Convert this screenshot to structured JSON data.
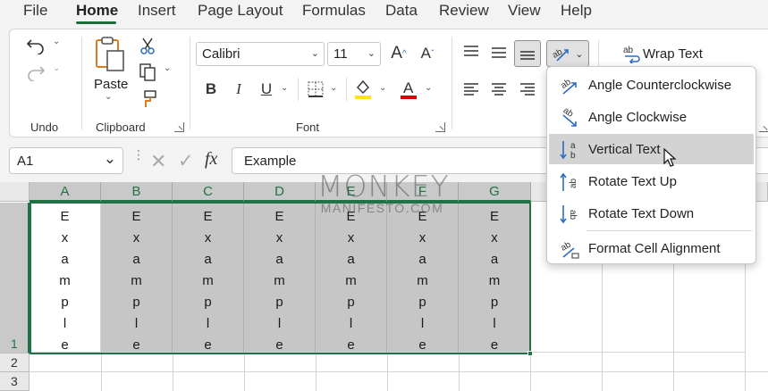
{
  "menu": {
    "tabs": [
      "File",
      "Home",
      "Insert",
      "Page Layout",
      "Formulas",
      "Data",
      "Review",
      "View",
      "Help"
    ],
    "active": "Home"
  },
  "ribbon": {
    "groups": {
      "undo": "Undo",
      "clipboard": "Clipboard",
      "font": "Font"
    },
    "clipboard": {
      "paste_label": "Paste"
    },
    "font": {
      "font_name": "Calibri",
      "font_size": "11"
    },
    "alignment": {
      "wrap_text_label": "Wrap Text"
    },
    "icons": {
      "undo": "undo-icon",
      "redo": "redo-icon",
      "paste": "paste-icon",
      "cut": "cut-icon",
      "copy": "copy-icon",
      "format_painter": "format-painter-icon",
      "increase_font": "increase-font-size-icon",
      "decrease_font": "decrease-font-size-icon",
      "bold": "bold-icon",
      "italic": "italic-icon",
      "underline": "underline-icon",
      "borders": "borders-icon",
      "fill_color": "fill-color-icon",
      "font_color": "font-color-icon",
      "orientation": "orientation-icon",
      "wrap": "wrap-text-icon"
    },
    "colors": {
      "fill": "#FFE600",
      "font": "#E00000"
    }
  },
  "formula_bar": {
    "name_box": "A1",
    "fx_label": "fx",
    "content": "Example"
  },
  "sheet": {
    "columns": [
      "A",
      "B",
      "C",
      "D",
      "E",
      "F",
      "G"
    ],
    "rows": [
      "1",
      "2",
      "3"
    ],
    "cell_text": [
      "E",
      "x",
      "a",
      "m",
      "p",
      "l",
      "e"
    ],
    "accent": "#217346",
    "selection_fill": "#C6C6C6"
  },
  "watermark": {
    "main": "MONKEY",
    "sub": "MANIFESTO.COM"
  },
  "orientation_menu": {
    "items": [
      {
        "label": "Angle Counterclockwise",
        "icon": "angle-counterclockwise-icon"
      },
      {
        "label": "Angle Clockwise",
        "icon": "angle-clockwise-icon"
      },
      {
        "label": "Vertical Text",
        "icon": "vertical-text-icon",
        "hovered": true
      },
      {
        "label": "Rotate Text Up",
        "icon": "rotate-text-up-icon"
      },
      {
        "label": "Rotate Text Down",
        "icon": "rotate-text-down-icon"
      },
      {
        "label": "Format Cell Alignment",
        "icon": "format-cell-alignment-icon"
      }
    ]
  }
}
